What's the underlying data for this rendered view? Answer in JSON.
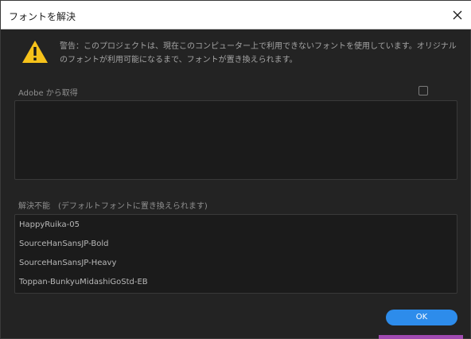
{
  "dialog": {
    "title": "フォントを解決",
    "close_icon": "close-icon",
    "warning": {
      "icon": "warning-icon",
      "icon_color": "#f6c21a",
      "text": "警告：このプロジェクトは、現在このコンピューター上で利用できないフォントを使用しています。オリジナルのフォントが利用可能になるまで、フォントが置き換えられます。"
    },
    "adobe_section": {
      "label": "Adobe から取得",
      "checkbox_checked": false
    },
    "unresolved_section": {
      "label": "解決不能　(デフォルトフォントに置き換えられます)",
      "fonts": [
        "HappyRuika-05",
        "SourceHanSansJP-Bold",
        "SourceHanSansJP-Heavy",
        "Toppan-BunkyuMidashiGoStd-EB"
      ]
    },
    "ok_label": "OK",
    "accent_color": "#2d8ceb"
  }
}
